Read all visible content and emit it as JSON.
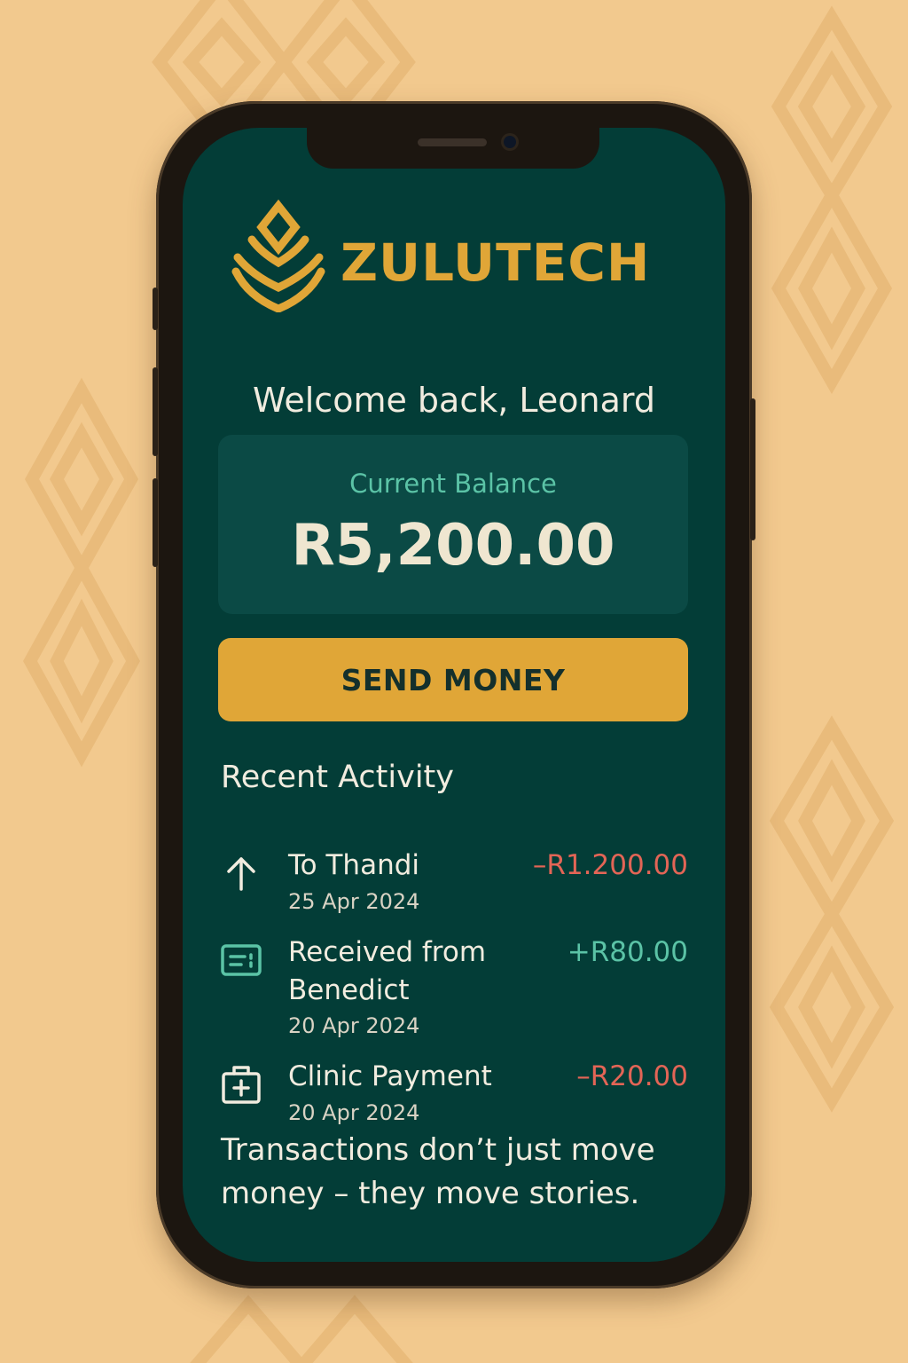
{
  "app": {
    "brand_name": "ZULUTECH",
    "colors": {
      "primary_bg": "#033d37",
      "accent": "#e0a637",
      "positive": "#5bc3a6",
      "negative": "#e36556"
    }
  },
  "header": {
    "welcome": "Welcome back, Leonard"
  },
  "balance": {
    "label": "Current Balance",
    "amount": "R5,200.00"
  },
  "actions": {
    "send_money_label": "SEND MONEY"
  },
  "activity": {
    "title": "Recent Activity",
    "transactions": [
      {
        "icon": "arrow-up-icon",
        "description": "To Thandi",
        "date": "25 Apr 2024",
        "amount": "–R1.200.00",
        "direction": "out"
      },
      {
        "icon": "receipt-card-icon",
        "description": "Received from Benedict",
        "date": "20 Apr 2024",
        "amount": "+R80.00",
        "direction": "in"
      },
      {
        "icon": "medical-kit-icon",
        "description": "Clinic Payment",
        "date": "20 Apr 2024",
        "amount": "–R20.00",
        "direction": "out"
      }
    ]
  },
  "footer": {
    "quote": "Transactions don’t just move money – they move stories."
  }
}
